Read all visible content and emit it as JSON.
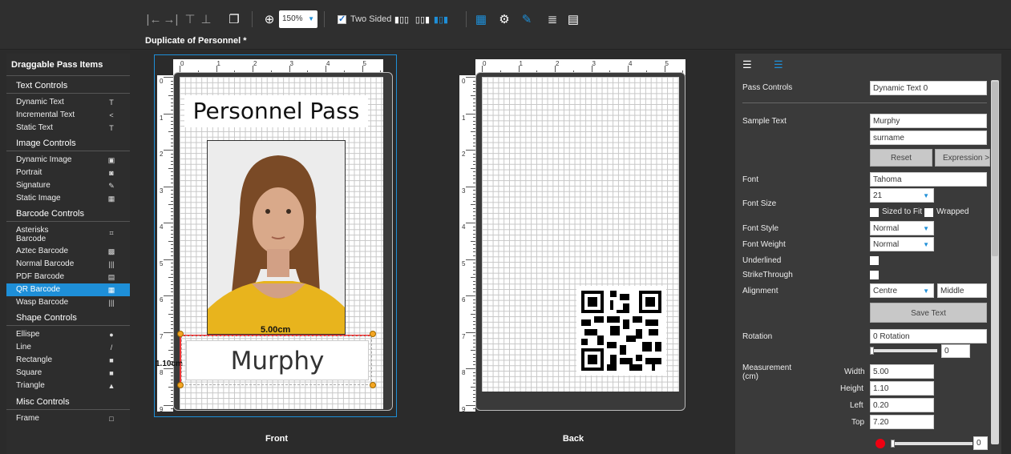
{
  "toolbar": {
    "zoom": "150%",
    "two_sided_label": "Two Sided",
    "two_sided_checked": true
  },
  "document": {
    "title": "Duplicate of Personnel *"
  },
  "left_panel": {
    "header": "Draggable Pass Items",
    "groups": [
      {
        "label": "Text Controls",
        "items": [
          {
            "label": "Dynamic Text",
            "icon": "T"
          },
          {
            "label": "Incremental Text",
            "icon": "<"
          },
          {
            "label": "Static Text",
            "icon": "T"
          }
        ]
      },
      {
        "label": "Image Controls",
        "items": [
          {
            "label": "Dynamic Image",
            "icon": "▣"
          },
          {
            "label": "Portrait",
            "icon": "◙"
          },
          {
            "label": "Signature",
            "icon": "✎"
          },
          {
            "label": "Static Image",
            "icon": "▦"
          }
        ]
      },
      {
        "label": "Barcode Controls",
        "items": [
          {
            "label": "Asterisks Barcode",
            "icon": "⌗"
          },
          {
            "label": "Aztec Barcode",
            "icon": "▩"
          },
          {
            "label": "Normal Barcode",
            "icon": "|||"
          },
          {
            "label": "PDF Barcode",
            "icon": "▤"
          },
          {
            "label": "QR Barcode",
            "icon": "▦"
          },
          {
            "label": "Wasp Barcode",
            "icon": "|||"
          }
        ]
      },
      {
        "label": "Shape Controls",
        "items": [
          {
            "label": "Ellispe",
            "icon": "●"
          },
          {
            "label": "Line",
            "icon": "/"
          },
          {
            "label": "Rectangle",
            "icon": "■"
          },
          {
            "label": "Square",
            "icon": "■"
          },
          {
            "label": "Triangle",
            "icon": "▲"
          }
        ]
      },
      {
        "label": "Misc Controls",
        "items": [
          {
            "label": "Frame",
            "icon": "□"
          }
        ]
      }
    ]
  },
  "front": {
    "label": "Front",
    "title_text": "Personnel Pass",
    "name_text": "Murphy",
    "width_measure": "5.00cm",
    "height_measure": "1.10cm",
    "ruler_h": [
      "0",
      "1",
      "2",
      "3",
      "4",
      "5"
    ],
    "ruler_v": [
      "0",
      "1",
      "2",
      "3",
      "4",
      "5",
      "6",
      "7",
      "8",
      "9"
    ]
  },
  "back": {
    "label": "Back",
    "ruler_h": [
      "0",
      "1",
      "2",
      "3",
      "4",
      "5"
    ],
    "ruler_v": [
      "0",
      "1",
      "2",
      "3",
      "4",
      "5",
      "6",
      "7",
      "8",
      "9"
    ]
  },
  "props": {
    "pass_controls_label": "Pass Controls",
    "pass_controls_value": "Dynamic Text 0",
    "sample_text_label": "Sample Text",
    "sample_text_value": "Murphy",
    "sample_text_field": "surname",
    "reset_label": "Reset",
    "expression_label": "Expression >",
    "font_label": "Font",
    "font_value": "Tahoma",
    "font_size_label": "Font Size",
    "font_size_value": "21",
    "sized_to_fit_label": "Sized to Fit",
    "wrapped_label": "Wrapped",
    "font_style_label": "Font Style",
    "font_style_value": "Normal",
    "font_weight_label": "Font Weight",
    "font_weight_value": "Normal",
    "underlined_label": "Underlined",
    "strikethrough_label": "StrikeThrough",
    "alignment_label": "Alignment",
    "alignment_h": "Centre",
    "alignment_v": "Middle",
    "save_text_label": "Save Text",
    "rotation_label": "Rotation",
    "rotation_value": "0 Rotation",
    "rotation_slider_value": "0",
    "measurement_label": "Measurement",
    "measurement_unit": "(cm)",
    "width_label": "Width",
    "width_value": "5.00",
    "height_label": "Height",
    "height_value": "1.10",
    "left_label": "Left",
    "left_value": "0.20",
    "top_label": "Top",
    "top_value": "7.20",
    "bottom_slider_value": "0"
  }
}
